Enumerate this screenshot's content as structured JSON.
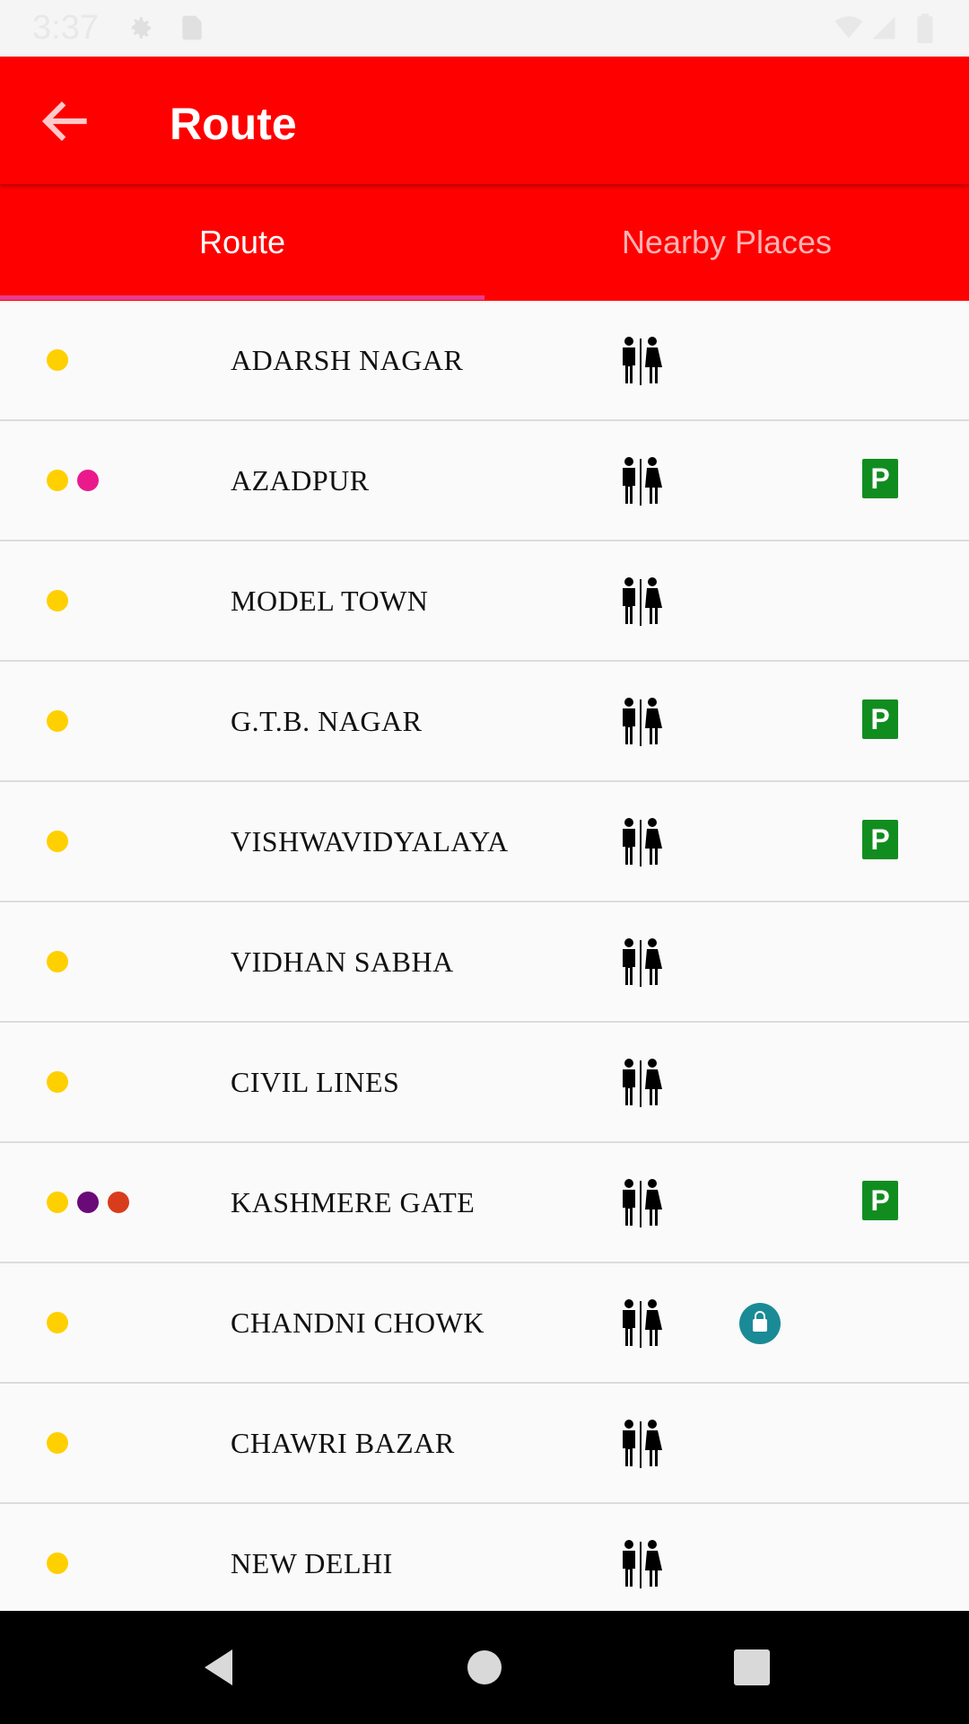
{
  "status_bar": {
    "time": "3:37"
  },
  "app_bar": {
    "title": "Route",
    "back_icon": "arrow-left-icon"
  },
  "tabs": [
    {
      "label": "Route",
      "selected": true
    },
    {
      "label": "Nearby Places",
      "selected": false
    }
  ],
  "colors": {
    "app_bar": "#ff0000",
    "tab_indicator": "#e93c8f",
    "yellow_line": "#ffd000",
    "pink_line": "#ea1a8c",
    "violet_line": "#6a0a78",
    "red_line": "#d83d1b",
    "parking": "#118d1f",
    "shop": "#1a8b96"
  },
  "stations": [
    {
      "name": "ADARSH NAGAR",
      "lines": [
        "#ffd000"
      ],
      "toilet": true,
      "shop": false,
      "parking": false
    },
    {
      "name": "AZADPUR",
      "lines": [
        "#ffd000",
        "#ea1a8c"
      ],
      "toilet": true,
      "shop": false,
      "parking": true
    },
    {
      "name": "MODEL TOWN",
      "lines": [
        "#ffd000"
      ],
      "toilet": true,
      "shop": false,
      "parking": false
    },
    {
      "name": "G.T.B. NAGAR",
      "lines": [
        "#ffd000"
      ],
      "toilet": true,
      "shop": false,
      "parking": true
    },
    {
      "name": "VISHWAVIDYALAYA",
      "lines": [
        "#ffd000"
      ],
      "toilet": true,
      "shop": false,
      "parking": true
    },
    {
      "name": "VIDHAN SABHA",
      "lines": [
        "#ffd000"
      ],
      "toilet": true,
      "shop": false,
      "parking": false
    },
    {
      "name": "CIVIL LINES",
      "lines": [
        "#ffd000"
      ],
      "toilet": true,
      "shop": false,
      "parking": false
    },
    {
      "name": "KASHMERE GATE",
      "lines": [
        "#ffd000",
        "#6a0a78",
        "#d83d1b"
      ],
      "toilet": true,
      "shop": false,
      "parking": true
    },
    {
      "name": "CHANDNI CHOWK",
      "lines": [
        "#ffd000"
      ],
      "toilet": true,
      "shop": true,
      "parking": false
    },
    {
      "name": "CHAWRI BAZAR",
      "lines": [
        "#ffd000"
      ],
      "toilet": true,
      "shop": false,
      "parking": false
    },
    {
      "name": "NEW DELHI",
      "lines": [
        "#ffd000"
      ],
      "toilet": true,
      "shop": false,
      "parking": false
    }
  ],
  "parking_label": "P",
  "nav_bar": {
    "icons": [
      "back-triangle-icon",
      "home-circle-icon",
      "recents-square-icon"
    ]
  }
}
